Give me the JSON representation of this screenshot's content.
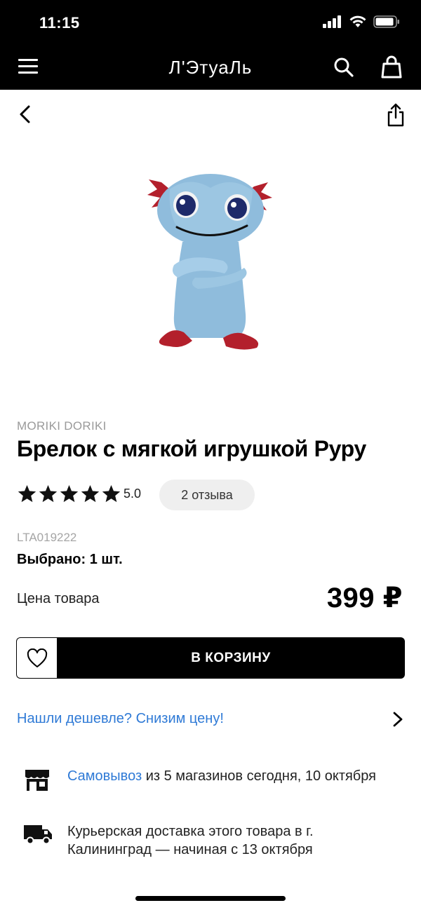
{
  "status": {
    "time": "11:15"
  },
  "header": {
    "brand": "Л'ЭтуаЛь"
  },
  "product": {
    "brand": "MORIKI DORIKI",
    "title": "Брелок с мягкой игрушкой Руру",
    "rating": "5.0",
    "reviews": "2 отзыва",
    "sku": "LTA019222",
    "selected": "Выбрано: 1 шт.",
    "price_label": "Цена товара",
    "price": "399 ₽"
  },
  "actions": {
    "cart_label": "В КОРЗИНУ"
  },
  "cheaper": {
    "label": "Нашли дешевле? Снизим цену!"
  },
  "delivery": {
    "pickup_link": "Самовывоз",
    "pickup_rest": " из 5 магазинов сегодня, 10 октября",
    "courier": "Курьерская доставка этого товара в г. Калининград — начиная с 13 октября"
  },
  "colors": {
    "accent_link": "#2f7ad6",
    "header_bg": "#000000",
    "pill_bg": "#efefef"
  },
  "icons": [
    "burger-icon",
    "search-icon",
    "bag-icon",
    "back-icon",
    "share-icon",
    "heart-icon",
    "chevron-right-icon",
    "store-icon",
    "truck-icon",
    "star-icon"
  ]
}
